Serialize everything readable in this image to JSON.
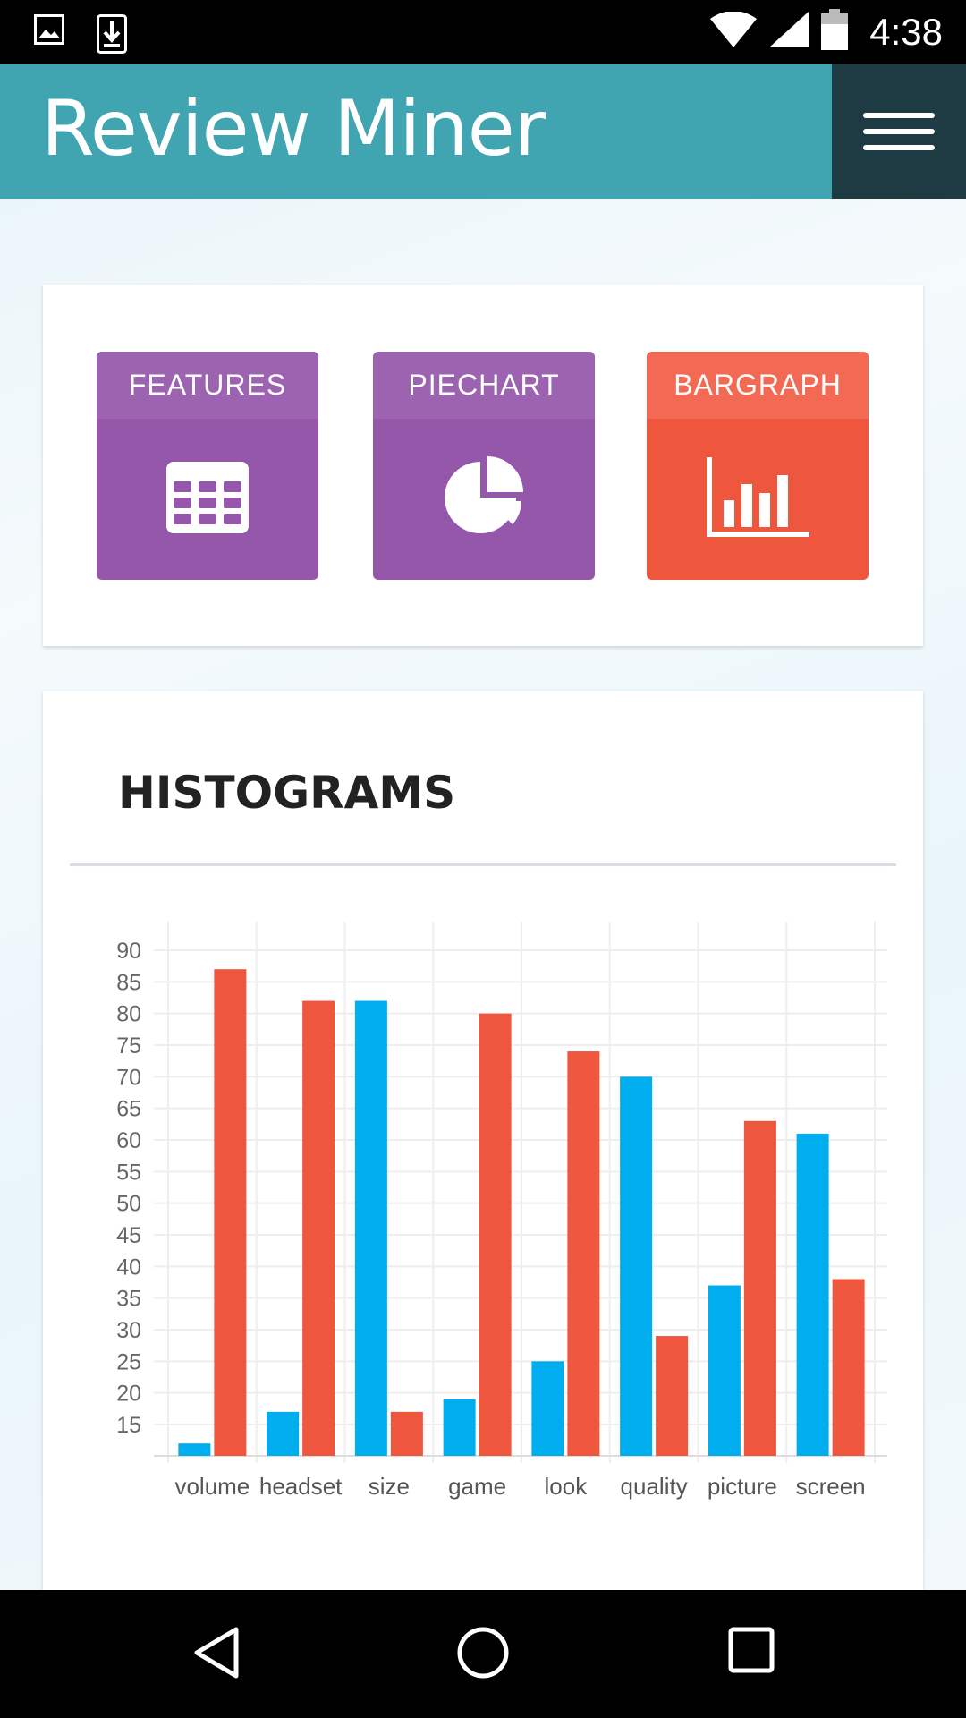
{
  "status_bar": {
    "time": "4:38",
    "icons": [
      "image-icon",
      "download-icon",
      "wifi-icon",
      "signal-icon",
      "battery-icon"
    ]
  },
  "app_bar": {
    "title": "Review Miner",
    "menu_icon": "hamburger-menu-icon",
    "background_color": "#41a5b1",
    "menu_background_color": "#1e3b43"
  },
  "nav_tiles": [
    {
      "label": "FEATURES",
      "icon": "table-grid-icon",
      "color": "#9457aa"
    },
    {
      "label": "PIECHART",
      "icon": "pie-chart-icon",
      "color": "#9457aa"
    },
    {
      "label": "BARGRAPH",
      "icon": "bar-chart-icon",
      "color": "#ef563e"
    }
  ],
  "histograms": {
    "title": "HISTOGRAMS"
  },
  "chart_data": {
    "type": "bar",
    "categories": [
      "volume",
      "headset",
      "size",
      "game",
      "look",
      "quality",
      "picture",
      "screen"
    ],
    "series": [
      {
        "values": [
          12,
          17,
          82,
          19,
          25,
          70,
          37,
          61
        ],
        "color": "#00adee"
      },
      {
        "values": [
          87,
          82,
          17,
          80,
          74,
          29,
          63,
          38
        ],
        "color": "#ef563e"
      }
    ],
    "yticks": [
      15,
      20,
      25,
      30,
      35,
      40,
      45,
      50,
      55,
      60,
      65,
      70,
      75,
      80,
      85,
      90
    ],
    "ylim": [
      10,
      90
    ],
    "grid": true,
    "title": "",
    "xlabel": "",
    "ylabel": ""
  },
  "system_nav": {
    "buttons": [
      "back-icon",
      "home-icon",
      "recents-icon"
    ]
  }
}
